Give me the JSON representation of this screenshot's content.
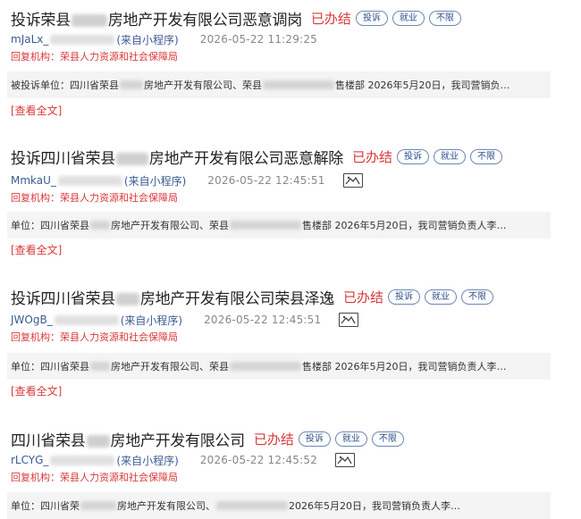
{
  "posts": [
    {
      "title_a": "投诉荣县",
      "title_b": "房地产开发有限公司恶意调岗",
      "status": "已办结",
      "tags": [
        "投诉",
        "就业",
        "不限"
      ],
      "user": "mJaLx_",
      "source": "(来自小程序)",
      "date": "2026-05-22 11:29:25",
      "reply": "回复机构：荣县人力资源和社会保障局",
      "excerpt_a": "被投诉单位：四川省荣县",
      "excerpt_b": "房地产开发有限公司、荣县",
      "excerpt_c": "售楼部 2026年5月20日，我司营销负…",
      "view_all": "[查看全文]",
      "has_image": false
    },
    {
      "title_a": "投诉四川省荣县",
      "title_b": "房地产开发有限公司恶意解除",
      "status": "已办结",
      "tags": [
        "投诉",
        "就业",
        "不限"
      ],
      "user": "MmkaU_",
      "source": "(来自小程序)",
      "date": "2026-05-22 12:45:51",
      "reply": "回复机构：荣县人力资源和社会保障局",
      "excerpt_a": "单位：四川省荣县",
      "excerpt_b": "房地产开发有限公司、荣县",
      "excerpt_c": "售楼部 2026年5月20日，我司营销负责人李…",
      "view_all": "[查看全文]",
      "has_image": true
    },
    {
      "title_a": "投诉四川省荣县",
      "title_b": "房地产开发有限公司荣县泽逸",
      "status": "已办结",
      "tags": [
        "投诉",
        "就业",
        "不限"
      ],
      "user": "JWOgB_",
      "source": "(来自小程序)",
      "date": "2026-05-22 12:45:51",
      "reply": "回复机构：荣县人力资源和社会保障局",
      "excerpt_a": "单位：四川省荣县",
      "excerpt_b": "房地产开发有限公司、荣县",
      "excerpt_c": "售楼部 2026年5月20日，我司营销负责人李…",
      "view_all": "[查看全文]",
      "has_image": true
    },
    {
      "title_a": "四川省荣县",
      "title_b": "房地产开发有限公司",
      "status": "已办结",
      "tags": [
        "投诉",
        "就业",
        "不限"
      ],
      "user": "rLCYG_",
      "source": "(来自小程序)",
      "date": "2026-05-22 12:45:52",
      "reply": "回复机构：荣县人力资源和社会保障局",
      "excerpt_a": "单位：四川省荣",
      "excerpt_b": "房地产开发有限公司、",
      "excerpt_c": "2026年5月20日，我司营销负责人李…",
      "view_all": "",
      "has_image": true
    }
  ]
}
